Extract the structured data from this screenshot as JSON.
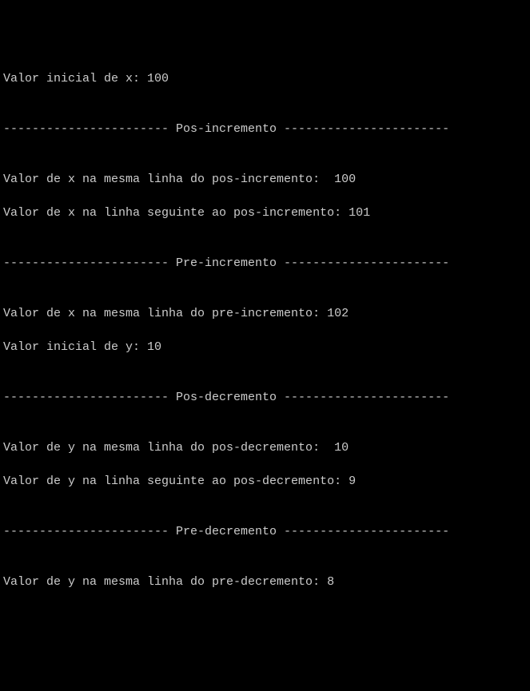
{
  "lines": [
    "Valor inicial de x: 100",
    "",
    "----------------------- Pos-incremento -----------------------",
    "",
    "Valor de x na mesma linha do pos-incremento:  100",
    "Valor de x na linha seguinte ao pos-incremento: 101",
    "",
    "----------------------- Pre-incremento -----------------------",
    "",
    "Valor de x na mesma linha do pre-incremento: 102",
    "Valor inicial de y: 10",
    "",
    "----------------------- Pos-decremento -----------------------",
    "",
    "Valor de y na mesma linha do pos-decremento:  10",
    "Valor de y na linha seguinte ao pos-decremento: 9",
    "",
    "----------------------- Pre-decremento -----------------------",
    "",
    "Valor de y na mesma linha do pre-decremento: 8",
    ""
  ]
}
